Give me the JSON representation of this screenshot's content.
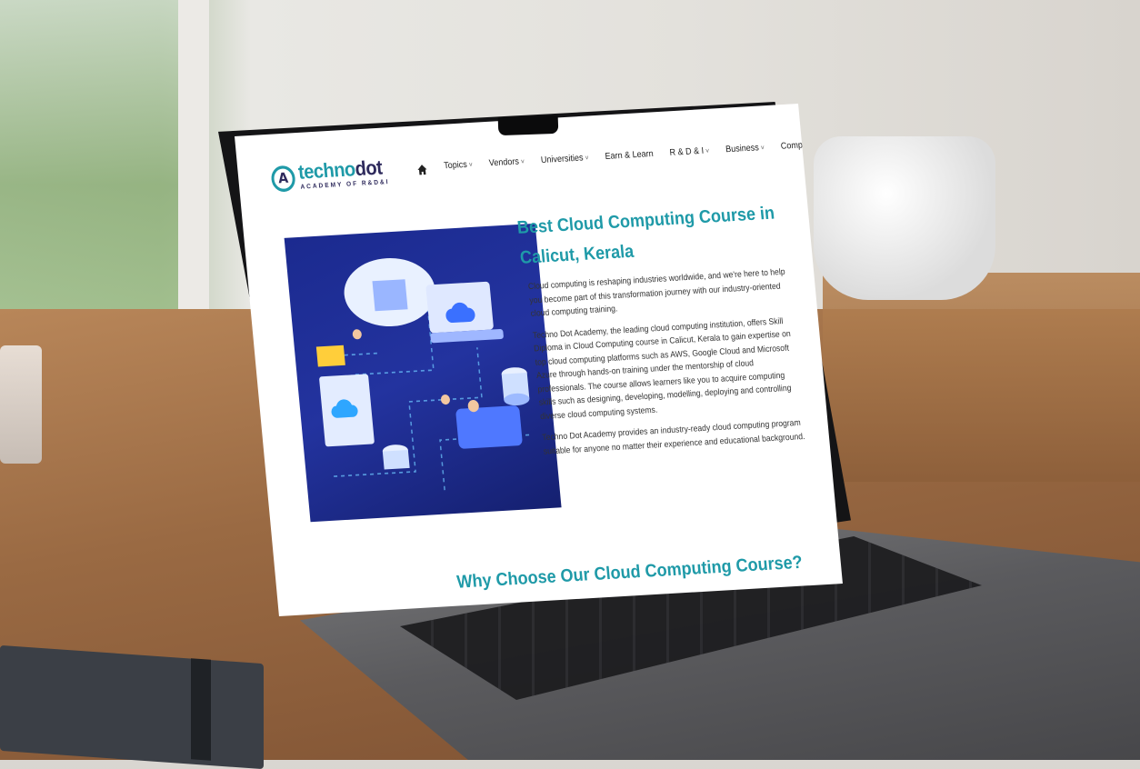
{
  "brand": {
    "name_a": "techno",
    "name_b": "dot",
    "tagline": "ACADEMY OF R&D&I",
    "mark": "A"
  },
  "nav": {
    "home_icon": "home-icon",
    "items": [
      {
        "label": "Topics",
        "has_dropdown": true
      },
      {
        "label": "Vendors",
        "has_dropdown": true
      },
      {
        "label": "Universities",
        "has_dropdown": true
      },
      {
        "label": "Earn & Learn",
        "has_dropdown": false
      },
      {
        "label": "R & D & I",
        "has_dropdown": true
      },
      {
        "label": "Business",
        "has_dropdown": true
      },
      {
        "label": "Company",
        "has_dropdown": true
      }
    ],
    "chevron": "˅"
  },
  "hero": {
    "title": "Best Cloud Computing Course in Calicut, Kerala",
    "paragraphs": [
      "Cloud computing is reshaping industries worldwide, and we're here to help you become  part of this transformation journey with our industry-oriented cloud computing training.",
      "Techno Dot Academy, the leading cloud computing institution, offers Skill Diploma in  Cloud Computing course in Calicut, Kerala to gain expertise on top cloud computing  platforms such as AWS, Google Cloud and Microsoft Azure through hands-on training  under the mentorship of cloud professionals. The course allows learners like you to  acquire computing skills such as designing, developing, modelling, deploying and  controlling diverse cloud computing systems.",
      "Techno Dot Academy provides an industry-ready cloud computing program suitable for  anyone no matter their experience and educational background."
    ],
    "image_icon": "cloud-computing-illustration"
  },
  "section2": {
    "title": "Why Choose Our Cloud Computing Course?"
  },
  "colors": {
    "accent": "#1f9aa8",
    "brand_dark": "#2e2a5c",
    "illustration_bg": "#1b2a8f"
  }
}
